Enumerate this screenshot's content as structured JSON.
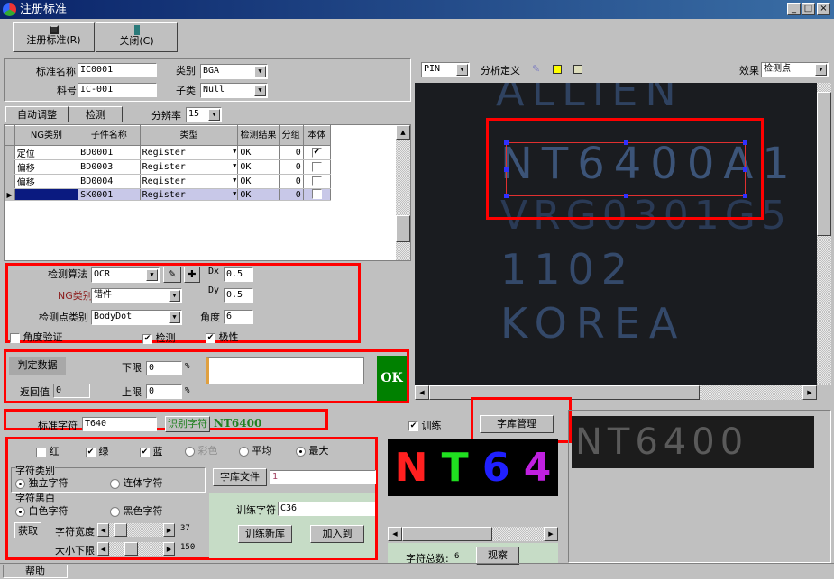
{
  "window": {
    "title": "注册标准",
    "minimize": "_",
    "maximize": "□",
    "close": "×"
  },
  "toolbar": {
    "register": "注册标准(R)",
    "close": "关闭(C)"
  },
  "form": {
    "std_name_label": "标准名称",
    "std_name": "IC0001",
    "part_label": "料号",
    "part": "IC-001",
    "category_label": "类别",
    "category": "BGA",
    "subcat_label": "子类",
    "subcat": "Null"
  },
  "actions": {
    "auto_adjust": "自动调整",
    "inspect": "检测",
    "resolution_label": "分辨率",
    "resolution": "15"
  },
  "grid": {
    "headers": [
      "NG类别",
      "子件名称",
      "类型",
      "检测结果",
      "分组",
      "本体"
    ],
    "rows": [
      {
        "ng": "定位",
        "name": "BD0001",
        "type": "Register",
        "result": "OK",
        "group": "0",
        "body": true
      },
      {
        "ng": "偏移",
        "name": "BD0003",
        "type": "Register",
        "result": "OK",
        "group": "0",
        "body": false
      },
      {
        "ng": "偏移",
        "name": "BD0004",
        "type": "Register",
        "result": "OK",
        "group": "0",
        "body": false
      },
      {
        "ng": "",
        "name": "SK0001",
        "type": "Register",
        "result": "OK",
        "group": "0",
        "body": false
      }
    ]
  },
  "algo": {
    "algo_label": "检测算法",
    "algo": "OCR",
    "ng_label": "NG类别",
    "ng": "错件",
    "point_label": "检测点类别",
    "point": "BodyDot",
    "dx_label": "Dx",
    "dx": "0.5",
    "dy_label": "Dy",
    "dy": "0.5",
    "angle_label": "角度",
    "angle": "6",
    "angle_check": "角度验证",
    "inspect": "检测",
    "polarity": "极性"
  },
  "judge": {
    "title": "判定数据",
    "lower_label": "下限",
    "lower": "0",
    "upper_label": "上限",
    "upper": "0",
    "pct": "%",
    "return_label": "返回值",
    "return": "0",
    "result": "OK"
  },
  "viewer": {
    "mode": "PIN",
    "analysis": "分析定义",
    "effect_label": "效果",
    "effect": "检测点",
    "image_lines": [
      "NT6400A1",
      "VRG0301G5",
      "1102",
      "KOREA"
    ]
  },
  "ocr": {
    "std_char_label": "标准字符",
    "std_char": "T640",
    "recognize": "识别字符",
    "recognized": "NT6400",
    "train_label": "训练",
    "lib_manage": "字库管理"
  },
  "channels": {
    "red": "红",
    "green": "绿",
    "blue": "蓝",
    "color": "彩色",
    "avg": "平均",
    "max": "最大"
  },
  "chartype": {
    "title": "字符类别",
    "single": "独立字符",
    "joined": "连体字符"
  },
  "charbw": {
    "title": "字符黑白",
    "white": "白色字符",
    "black": "黑色字符",
    "fetch": "获取",
    "width_label": "字符宽度",
    "width": "37",
    "size_label": "大小下限",
    "size": "150"
  },
  "lib": {
    "file_btn": "字库文件",
    "file": "1",
    "train_char_label": "训练字符",
    "train_char": "C36",
    "train_new": "训练新库",
    "add_to": "加入到"
  },
  "preview": {
    "chars": [
      "N",
      "T",
      "6",
      "4"
    ],
    "colors": [
      "#ff2020",
      "#20e020",
      "#2020ff",
      "#c020e0"
    ],
    "total_label": "字符总数:",
    "total": "6",
    "view": "观察",
    "sample": "NT6400"
  },
  "status": {
    "help": "帮助"
  }
}
